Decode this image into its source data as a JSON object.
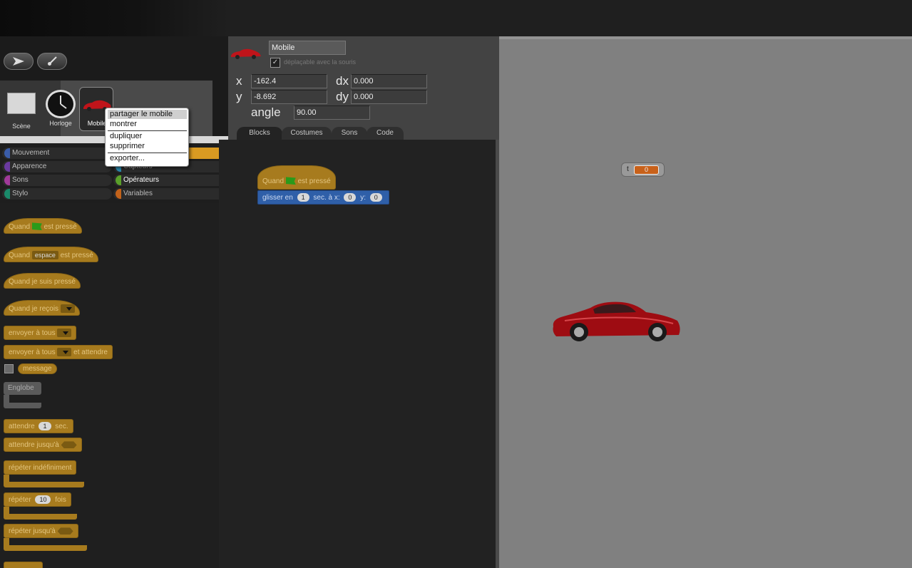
{
  "toolbar": {
    "arrow_icon": "arrow-icon",
    "brush_icon": "paintbrush-icon"
  },
  "corral": {
    "stage_label": "Scène",
    "clock_label": "Horloge",
    "mobile_label": "Mobile"
  },
  "categories": {
    "mouvement": "Mouvement",
    "apparence": "Apparence",
    "sons": "Sons",
    "stylo": "Stylo",
    "controle": "",
    "capteurs": "Capteurs",
    "operateurs": "Opérateurs",
    "variables": "Variables"
  },
  "palette": {
    "quand": "Quand",
    "est_presse": "est pressé",
    "espace": "espace",
    "quand_je_suis_presse": "Quand je suis pressé",
    "quand_je_recois": "Quand je reçois",
    "envoyer_a_tous": "envoyer à tous",
    "et_attendre": "et attendre",
    "message": "message",
    "englobe": "Englobe",
    "attendre": "attendre",
    "attendre_val": "1",
    "sec": "sec.",
    "attendre_jusqua": "attendre jusqu'à",
    "repeter_indefiniment": "répéter indéfiniment",
    "repeter": "répéter",
    "repeter_val": "10",
    "fois": "fois",
    "repeter_jusqua": "répéter jusqu'à"
  },
  "sprite": {
    "name": "Mobile",
    "draggable_label": "déplaçable avec la souris",
    "draggable_checked": "✓",
    "x_label": "x",
    "x_value": "-162.4",
    "y_label": "y",
    "y_value": "-8.692",
    "dx_label": "dx",
    "dx_value": "0.000",
    "dy_label": "dy",
    "dy_value": "0.000",
    "angle_label": "angle",
    "angle_value": "90.00"
  },
  "tabs": [
    "Blocks",
    "Costumes",
    "Sons",
    "Code"
  ],
  "script": {
    "quand": "Quand",
    "est_presse": "est pressé",
    "glisser_en": "glisser en",
    "glisser_val": "1",
    "sec_a_x": "sec. à x:",
    "x_val": "0",
    "y_lbl": "y:",
    "y_val": "0"
  },
  "watcher": {
    "label": "t",
    "value": "0"
  },
  "context_menu": {
    "items": [
      "partager le mobile",
      "montrer",
      "dupliquer",
      "supprimer",
      "exporter..."
    ]
  },
  "colors": {
    "control_block": "#a77b1e",
    "motion_block": "#2f5fa8",
    "stage_bg": "#808080",
    "selected_category": "#d99a22"
  }
}
